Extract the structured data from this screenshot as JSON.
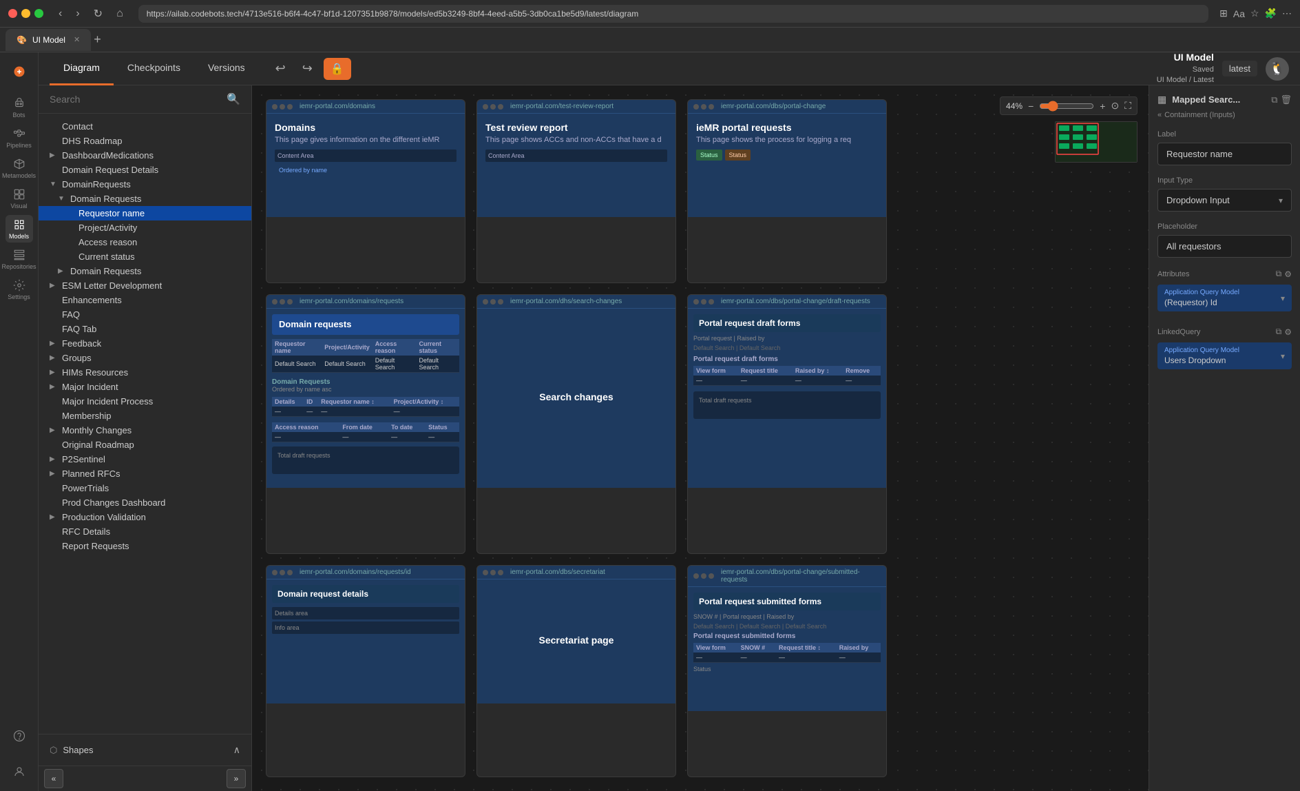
{
  "browser": {
    "url": "https://ailab.codebots.tech/4713e516-b6f4-4c47-bf1d-1207351b9878/models/ed5b3249-8bf4-4eed-a5b5-3db0ca1be5d9/latest/diagram",
    "tab_title": "UI Model",
    "tab_icon": "🎨"
  },
  "app": {
    "title": "UI Model",
    "saved": "Saved",
    "path": "UI Model / Latest",
    "version_badge": "latest"
  },
  "toolbar": {
    "tabs": [
      "Diagram",
      "Checkpoints",
      "Versions"
    ]
  },
  "sidebar": {
    "search_placeholder": "Search",
    "items": [
      {
        "label": "Contact",
        "level": 1,
        "type": "item"
      },
      {
        "label": "DHS Roadmap",
        "level": 1,
        "type": "item"
      },
      {
        "label": "DashboardMedications",
        "level": 1,
        "type": "folder",
        "expanded": false
      },
      {
        "label": "Domain Request Details",
        "level": 1,
        "type": "item"
      },
      {
        "label": "DomainRequests",
        "level": 1,
        "type": "folder",
        "expanded": true
      },
      {
        "label": "Domain Requests",
        "level": 2,
        "type": "folder",
        "expanded": true
      },
      {
        "label": "Requestor name",
        "level": 3,
        "type": "item",
        "selected": true
      },
      {
        "label": "Project/Activity",
        "level": 3,
        "type": "item"
      },
      {
        "label": "Access reason",
        "level": 3,
        "type": "item"
      },
      {
        "label": "Current status",
        "level": 3,
        "type": "item"
      },
      {
        "label": "Domain Requests",
        "level": 2,
        "type": "folder",
        "expanded": false
      },
      {
        "label": "ESM Letter Development",
        "level": 1,
        "type": "folder",
        "expanded": false
      },
      {
        "label": "Enhancements",
        "level": 1,
        "type": "item"
      },
      {
        "label": "FAQ",
        "level": 1,
        "type": "item"
      },
      {
        "label": "FAQ Tab",
        "level": 1,
        "type": "item"
      },
      {
        "label": "Feedback",
        "level": 1,
        "type": "folder",
        "expanded": false
      },
      {
        "label": "Groups",
        "level": 1,
        "type": "folder",
        "expanded": false
      },
      {
        "label": "HIMs Resources",
        "level": 1,
        "type": "folder",
        "expanded": false
      },
      {
        "label": "Major Incident",
        "level": 1,
        "type": "folder",
        "expanded": false
      },
      {
        "label": "Major Incident Process",
        "level": 1,
        "type": "item"
      },
      {
        "label": "Membership",
        "level": 1,
        "type": "item"
      },
      {
        "label": "Monthly Changes",
        "level": 1,
        "type": "folder",
        "expanded": false
      },
      {
        "label": "Original Roadmap",
        "level": 1,
        "type": "item"
      },
      {
        "label": "P2Sentinel",
        "level": 1,
        "type": "folder",
        "expanded": false
      },
      {
        "label": "Planned RFCs",
        "level": 1,
        "type": "folder",
        "expanded": false
      },
      {
        "label": "PowerTrials",
        "level": 1,
        "type": "item"
      },
      {
        "label": "Prod Changes Dashboard",
        "level": 1,
        "type": "item"
      },
      {
        "label": "Production Validation",
        "level": 1,
        "type": "folder",
        "expanded": false
      },
      {
        "label": "RFC Details",
        "level": 1,
        "type": "item"
      },
      {
        "label": "Report Requests",
        "level": 1,
        "type": "item"
      }
    ],
    "bottom": {
      "shapes_label": "Shapes"
    }
  },
  "rail": {
    "items": [
      {
        "label": "Bots",
        "icon": "bot"
      },
      {
        "label": "Pipelines",
        "icon": "pipeline"
      },
      {
        "label": "Metamodels",
        "icon": "meta"
      },
      {
        "label": "Visual",
        "icon": "visual"
      },
      {
        "label": "Models",
        "icon": "models",
        "active": true
      },
      {
        "label": "Repositories",
        "icon": "repo"
      },
      {
        "label": "Settings",
        "icon": "settings"
      }
    ]
  },
  "cards": [
    {
      "id": 1,
      "url": "iemr-portal.com/domains",
      "title": "Domains",
      "subtitle": "This page gives information on the different ieMR",
      "type": "info"
    },
    {
      "id": 2,
      "url": "iemr-portal.com/test-review-report",
      "title": "Test review report",
      "subtitle": "This page shows ACCs and non-ACCs that have a d",
      "type": "info"
    },
    {
      "id": 3,
      "url": "iemr-portal.com/dbs/portal-change",
      "title": "ieMR portal requests",
      "subtitle": "This page shows the process for logging a req",
      "type": "info"
    },
    {
      "id": 4,
      "url": "iemr-portal.com/domains/requests",
      "title": "Domain requests",
      "subtitle": "",
      "type": "table",
      "columns": [
        "Requestor name",
        "Project/Activity",
        "Access reason",
        "Current status"
      ],
      "rows": [
        [
          "Default Search",
          "Default Search",
          "Default Search",
          "Default Search"
        ]
      ]
    },
    {
      "id": 5,
      "url": "iemr-portal.com/dhs/search-changes",
      "title": "Search changes",
      "subtitle": "",
      "type": "info"
    },
    {
      "id": 6,
      "url": "iemr-portal.com/dbs/portal-change/draft-requests",
      "title": "Portal request draft forms",
      "subtitle": "",
      "type": "table"
    },
    {
      "id": 7,
      "url": "iemr-portal.com/domains/requests/id",
      "title": "Domain request details",
      "subtitle": "",
      "type": "detail"
    },
    {
      "id": 8,
      "url": "iemr-portal.com/dbs/secretariat",
      "title": "Secretariat page",
      "subtitle": "",
      "type": "info"
    },
    {
      "id": 9,
      "url": "iemr-portal.com/dbs/portal-change/submitted-requests",
      "title": "Portal request submitted forms",
      "subtitle": "",
      "type": "table"
    }
  ],
  "zoom": {
    "level": "44%"
  },
  "right_panel": {
    "title": "Mapped Searc...",
    "breadcrumb": "Containment (Inputs)",
    "label_section": "Label",
    "label_value": "Requestor name",
    "input_type_section": "Input Type",
    "input_type_value": "Dropdown Input",
    "placeholder_section": "Placeholder",
    "placeholder_value": "All requestors",
    "attributes_section": "Attributes",
    "attr1_label": "Application Query Model",
    "attr1_value": "(Requestor) Id",
    "linked_query_section": "LinkedQuery",
    "linked_query_label": "Application Query Model",
    "linked_query_value": "Users Dropdown"
  }
}
